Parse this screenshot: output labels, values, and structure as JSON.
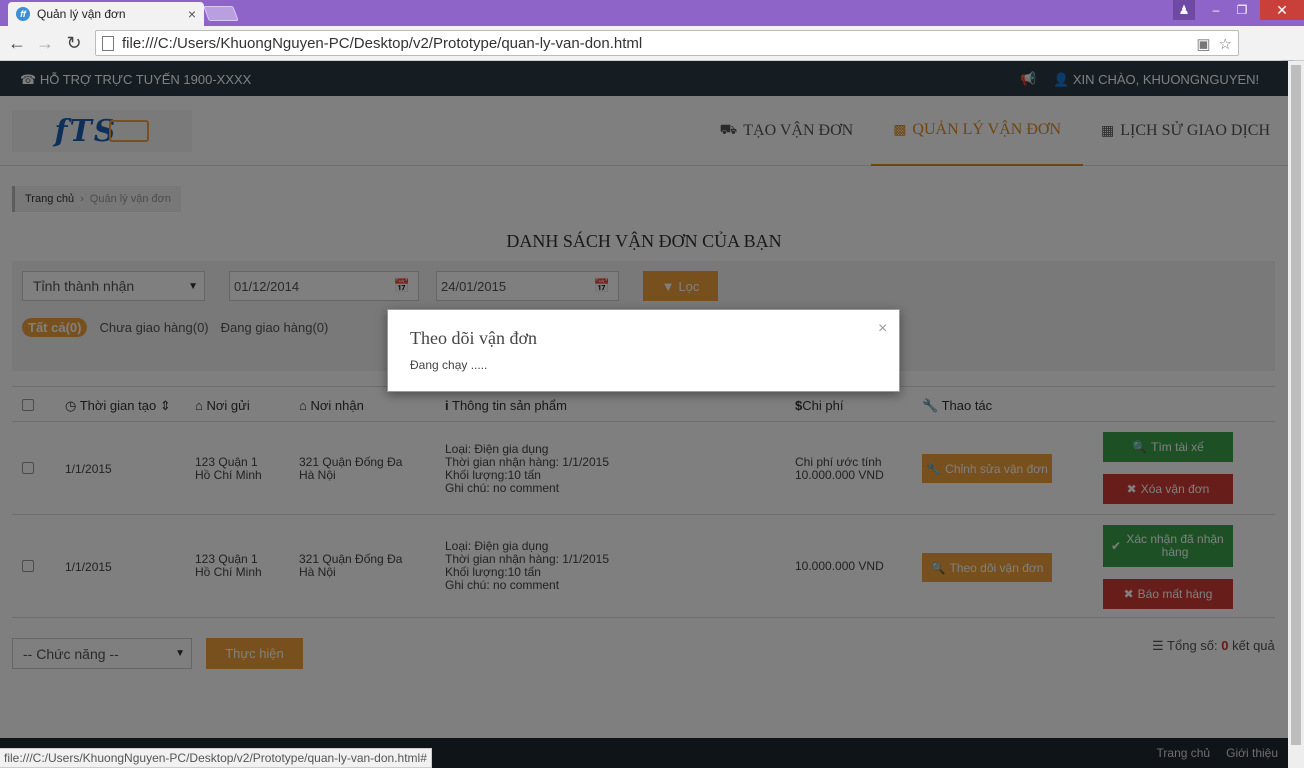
{
  "browser": {
    "tab_title": "Quản lý vận đơn",
    "tab_favicon": "ff",
    "url": "file:///C:/Users/KhuongNguyen-PC/Desktop/v2/Prototype/quan-ly-van-don.html",
    "status_url": "file:///C:/Users/KhuongNguyen-PC/Desktop/v2/Prototype/quan-ly-van-don.html#"
  },
  "topbar": {
    "support": "HỖ TRỢ TRỰC TUYẾN 1900-XXXX",
    "greeting": "XIN CHÀO, KHUONGNGUYEN!"
  },
  "header": {
    "logo_text": "fTS",
    "nav": [
      {
        "label": "TẠO VẬN ĐƠN",
        "icon": "truck-icon"
      },
      {
        "label": "QUẢN LÝ VẬN ĐƠN",
        "icon": "monitor-icon",
        "active": true
      },
      {
        "label": "LỊCH SỬ GIAO DỊCH",
        "icon": "bar-chart-icon"
      }
    ]
  },
  "breadcrumb": {
    "home": "Trang chủ",
    "current": "Quản lý vận đơn"
  },
  "page_title": "DANH SÁCH VẬN ĐƠN CỦA BẠN",
  "filters": {
    "province": "Tỉnh thành nhận",
    "date_from": "01/12/2014",
    "date_to": "24/01/2015",
    "filter_button": "Lọc",
    "tabs": [
      "Tất cả(0)",
      "Chưa giao hàng(0)",
      "Đang giao hàng(0)"
    ]
  },
  "table": {
    "headers": {
      "created": "Thời gian tạo",
      "sender": "Nơi gửi",
      "receiver": "Nơi nhận",
      "product": "Thông tin sản phẩm",
      "cost": "Chi phí",
      "action": "Thao tác"
    },
    "rows": [
      {
        "date": "1/1/2015",
        "sender_1": "123 Quận 1",
        "sender_2": "Hồ Chí Minh",
        "receiver_1": "321 Quận Đống Đa",
        "receiver_2": "Hà Nội",
        "product_1": "Loại: Điện gia dụng",
        "product_2": "Thời gian nhận hàng: 1/1/2015",
        "product_3": "Khối lượng:10 tấn",
        "product_4": "Ghi chú: no comment",
        "cost_1": "Chi phí ước tính",
        "cost_2": "10.000.000 VND",
        "action_button": "Chỉnh sửa vận đơn",
        "green_button": "Tìm tài xế",
        "red_button": "Xóa vận đơn"
      },
      {
        "date": "1/1/2015",
        "sender_1": "123 Quận 1",
        "sender_2": "Hồ Chí Minh",
        "receiver_1": "321 Quận Đống Đa",
        "receiver_2": "Hà Nội",
        "product_1": "Loại: Điện gia dụng",
        "product_2": "Thời gian nhận hàng: 1/1/2015",
        "product_3": "Khối lượng:10 tấn",
        "product_4": "Ghi chú: no comment",
        "cost_1": "",
        "cost_2": "10.000.000 VND",
        "action_button": "Theo dõi vận đơn",
        "green_button": "Xác nhận đã nhận hàng",
        "red_button": "Báo mất hàng"
      }
    ]
  },
  "bottom": {
    "function_select": "-- Chức năng --",
    "execute_button": "Thực hiện",
    "total_label": "Tổng số:",
    "total_count": "0",
    "total_suffix": "kết quả"
  },
  "footer": {
    "links": [
      "Trang chủ",
      "Giới thiệu"
    ]
  },
  "modal": {
    "title": "Theo dõi vận đơn",
    "body": "Đang chạy .....",
    "close": "×"
  },
  "colors": {
    "accent": "#f0a13b",
    "topbar": "#2b3a46",
    "success": "#3aa34a",
    "danger": "#cf3a35",
    "browser_frame": "#8f64c8"
  }
}
